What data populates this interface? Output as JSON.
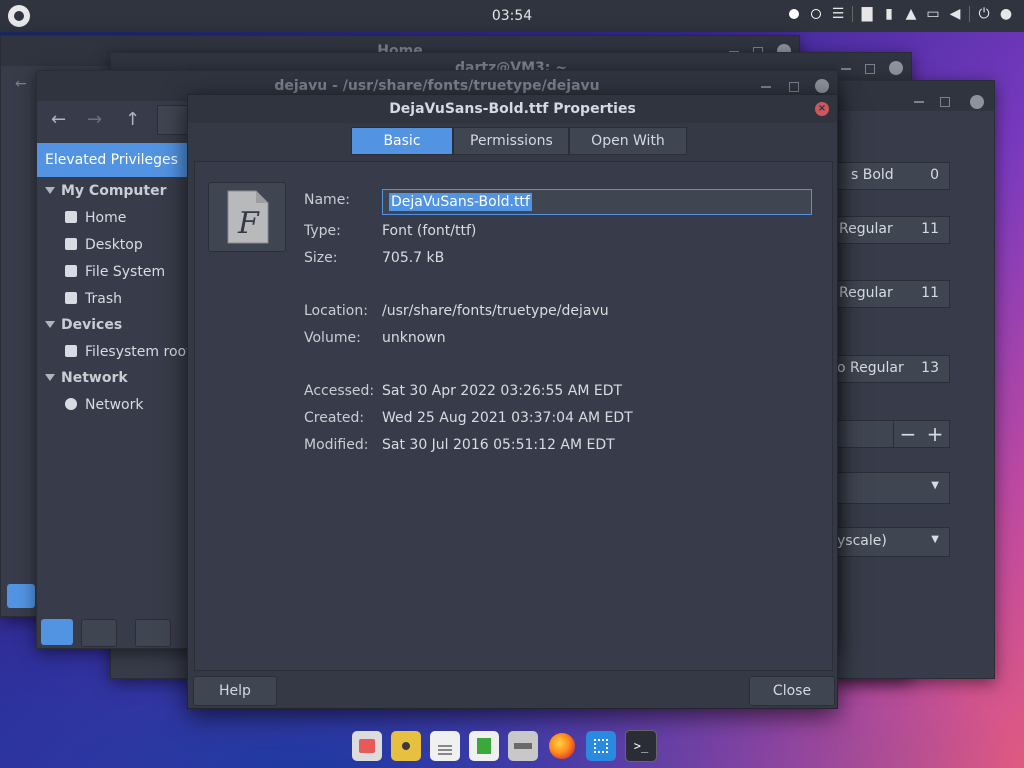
{
  "panel": {
    "clock": "03:54"
  },
  "windows": {
    "home_title": "Home",
    "terminal_title": "dartz@VM3: ~",
    "nemo_title": "dejavu - /usr/share/fonts/truetype/dejavu"
  },
  "nemo": {
    "sidebar": {
      "elevated": "Elevated Privileges",
      "my_computer": "My Computer",
      "items": [
        "Home",
        "Desktop",
        "File System",
        "Trash"
      ],
      "devices": "Devices",
      "device_items": [
        "Filesystem root"
      ],
      "network": "Network",
      "network_items": [
        "Network"
      ]
    }
  },
  "font_viewer": {
    "rows": [
      {
        "label": "s Bold",
        "size": "0"
      },
      {
        "label": "Regular",
        "size": "11"
      },
      {
        "label": "Regular",
        "size": "11"
      },
      {
        "label": "o Regular",
        "size": "13"
      }
    ],
    "combo2": "yscale)"
  },
  "dialog": {
    "title": "DejaVuSans-Bold.ttf Properties",
    "tabs": {
      "basic": "Basic",
      "permissions": "Permissions",
      "open_with": "Open With"
    },
    "name_label": "Name:",
    "name_value": "DejaVuSans-Bold.ttf",
    "type_label": "Type:",
    "type_value": "Font (font/ttf)",
    "size_label": "Size:",
    "size_value": "705.7 kB",
    "location_label": "Location:",
    "location_value": "/usr/share/fonts/truetype/dejavu",
    "volume_label": "Volume:",
    "volume_value": "unknown",
    "accessed_label": "Accessed:",
    "accessed_value": "Sat 30 Apr 2022 03:26:55 AM EDT",
    "created_label": "Created:",
    "created_value": "Wed 25 Aug 2021 03:37:04 AM EDT",
    "modified_label": "Modified:",
    "modified_value": "Sat 30 Jul 2016 05:51:12 AM EDT",
    "help": "Help",
    "close": "Close"
  },
  "colors": {
    "accent": "#5294e2",
    "close": "#cc575d",
    "panel": "#2f343f"
  }
}
